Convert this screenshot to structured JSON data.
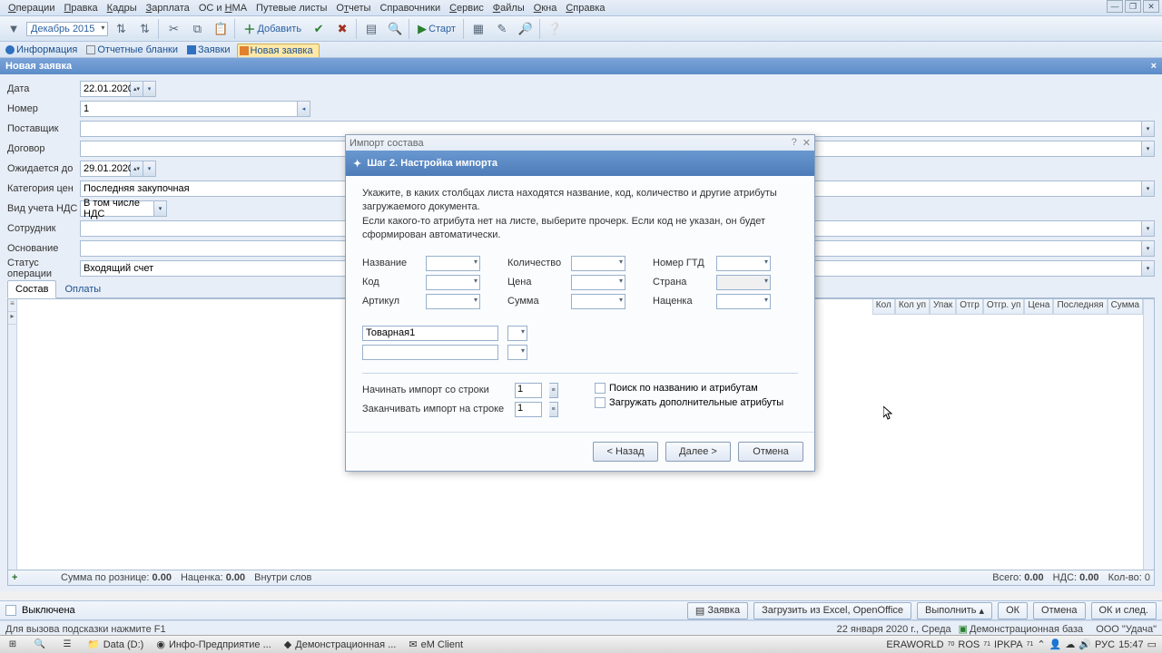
{
  "menu": [
    "Операции",
    "Правка",
    "Кадры",
    "Зарплата",
    "ОС и НМА",
    "Путевые листы",
    "Отчеты",
    "Справочники",
    "Сервис",
    "Файлы",
    "Окна",
    "Справка"
  ],
  "toolbar": {
    "month": "Декабрь 2015",
    "add": "Добавить",
    "start": "Старт"
  },
  "tabs": {
    "info": "Информация",
    "forms": "Отчетные бланки",
    "requests": "Заявки",
    "new_req": "Новая заявка"
  },
  "subheader": "Новая заявка",
  "form": {
    "labels": {
      "date": "Дата",
      "num": "Номер",
      "supplier": "Поставщик",
      "contract": "Договор",
      "expected": "Ожидается до",
      "pricectg": "Категория цен",
      "vat": "Вид учета НДС",
      "employee": "Сотрудник",
      "basis": "Основание",
      "status": "Статус операции"
    },
    "date": "22.01.2020",
    "num": "1",
    "expected": "29.01.2020",
    "pricectg": "Последняя закупочная",
    "vat": "В том числе НДС",
    "status": "Входящий счет"
  },
  "inner_tabs": {
    "content": "Состав",
    "payments": "Оплаты"
  },
  "grid_headers": [
    "Кол",
    "Кол уп",
    "Упак",
    "Отгр",
    "Отгр. уп",
    "Цена",
    "Последняя",
    "Сумма"
  ],
  "grid_footer": {
    "retail": "Сумма по рознице:",
    "retail_v": "0.00",
    "margin": "Наценка:",
    "margin_v": "0.00",
    "inside": "Внутри слов",
    "totals": "Всего:",
    "totals_v": "0.00",
    "vat": "НДС:",
    "vat_v": "0.00",
    "count": "Кол-во: 0"
  },
  "bottom": {
    "disabled": "Выключена",
    "request": "Заявка",
    "load": "Загрузить из Excel, OpenOffice",
    "exec": "Выполнить",
    "ok": "ОК",
    "cancel": "Отмена",
    "oknext": "ОК и след."
  },
  "status_line": {
    "hint": "Для вызова подсказки нажмите F1",
    "date": "22 января 2020 г., Среда",
    "db": "Демонстрационная база",
    "org": "ООО \"Удача\""
  },
  "taskbar": {
    "data": "Data (D:)",
    "info": "Инфо-Предприятие ...",
    "demo": "Демонстрационная ...",
    "em": "eM Client",
    "era": "ERAWORLD",
    "ros": "ROS",
    "ipkpa": "IPKPA",
    "lang": "РУС",
    "time": "15:47"
  },
  "modal": {
    "title": "Импорт состава",
    "header": "Шаг 2. Настройка импорта",
    "instr1": "Укажите, в каких столбцах листа находятся название, код, количество и другие атрибуты загружаемого документа.",
    "instr2": "Если какого-то атрибута нет на листе, выберите прочерк. Если код не указан, он будет сформирован автоматически.",
    "cols": {
      "name": "Название",
      "code": "Код",
      "article": "Артикул",
      "qty": "Количество",
      "price": "Цена",
      "sum": "Сумма",
      "gtd": "Номер ГТД",
      "country": "Страна",
      "markup": "Наценка"
    },
    "extra": "Товарная1",
    "start_label": "Начинать импорт со строки",
    "start_v": "1",
    "end_label": "Заканчивать импорт на строке",
    "end_v": "1",
    "chk_search": "Поиск по названию и атрибутам",
    "chk_load": "Загружать дополнительные атрибуты",
    "back": "< Назад",
    "next": "Далее >",
    "cancel": "Отмена"
  }
}
